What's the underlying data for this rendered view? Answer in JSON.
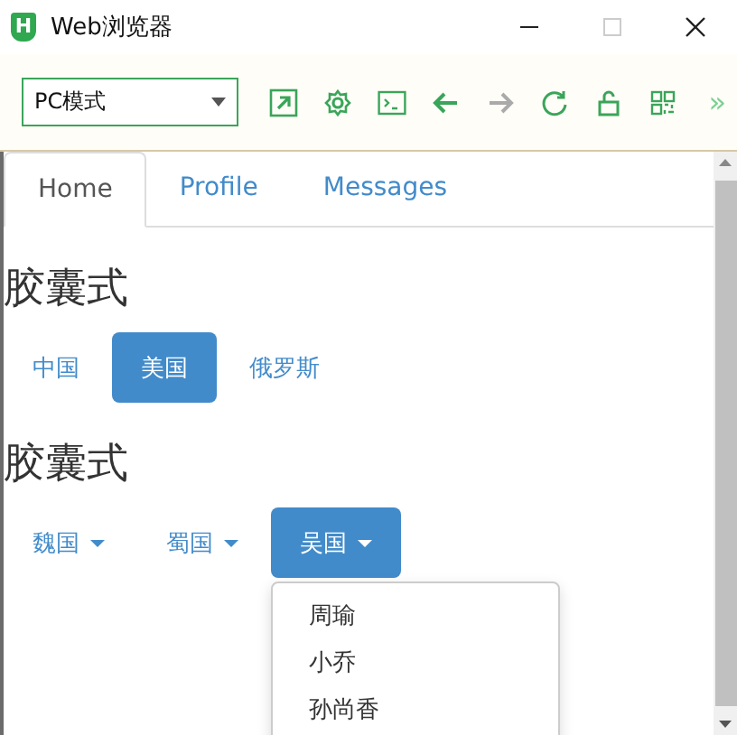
{
  "window": {
    "title": "Web浏览器",
    "app_icon_letter": "H",
    "maximize_disabled": true
  },
  "toolbar": {
    "mode_select": {
      "value": "PC模式"
    },
    "buttons": [
      {
        "kind": "popout",
        "disabled": false
      },
      {
        "kind": "gear",
        "disabled": false
      },
      {
        "kind": "console",
        "disabled": false
      },
      {
        "kind": "back",
        "disabled": false
      },
      {
        "kind": "forward",
        "disabled": true
      },
      {
        "kind": "reload",
        "disabled": false
      },
      {
        "kind": "lock",
        "disabled": false
      },
      {
        "kind": "qr",
        "disabled": false
      }
    ],
    "overflow": "»"
  },
  "tabs": [
    {
      "label": "Home",
      "selected": true
    },
    {
      "label": "Profile",
      "selected": false
    },
    {
      "label": "Messages",
      "selected": false
    }
  ],
  "sections": [
    {
      "heading": "胶囊式",
      "kind": "pills",
      "items": [
        {
          "label": "中国",
          "selected": false
        },
        {
          "label": "美国",
          "selected": true
        },
        {
          "label": "俄罗斯",
          "selected": false
        }
      ]
    },
    {
      "heading": "胶囊式",
      "kind": "dropdowns",
      "items": [
        {
          "label": "魏国",
          "selected": false
        },
        {
          "label": "蜀国",
          "selected": false
        },
        {
          "label": "吴国",
          "selected": true
        }
      ],
      "menu": {
        "items": [
          "周瑜",
          "小乔",
          "孙尚香"
        ]
      }
    }
  ]
}
